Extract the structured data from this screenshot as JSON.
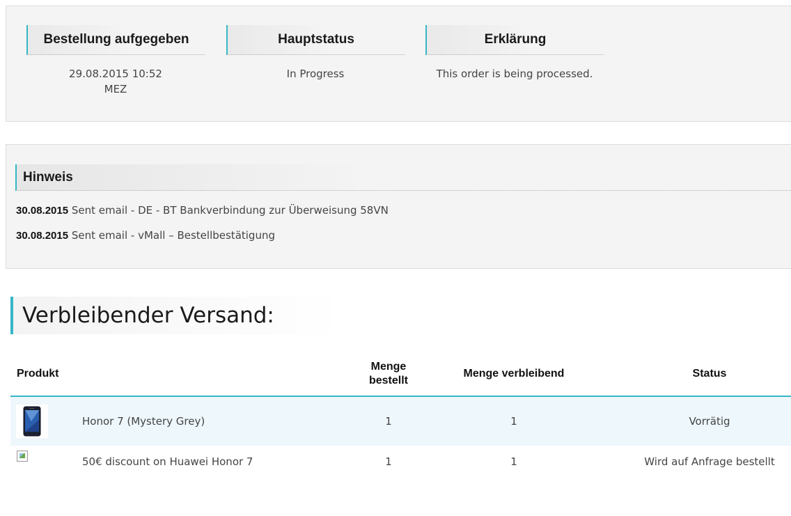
{
  "status_panel": {
    "columns": [
      {
        "header": "Bestellung aufgegeben",
        "value_line1": "29.08.2015 10:52",
        "value_line2": "MEZ"
      },
      {
        "header": "Hauptstatus",
        "value_line1": "In Progress",
        "value_line2": ""
      },
      {
        "header": "Erklärung",
        "value_line1": "This order is being processed.",
        "value_line2": ""
      }
    ]
  },
  "notes": {
    "title": "Hinweis",
    "items": [
      {
        "date": "30.08.2015",
        "text": "Sent email - DE - BT Bankverbindung zur Überweisung 58VN"
      },
      {
        "date": "30.08.2015",
        "text": "Sent email - vMall – Bestellbestätigung"
      }
    ]
  },
  "shipping": {
    "title": "Verbleibender Versand:",
    "headers": {
      "product": "Produkt",
      "qty_ordered_line1": "Menge",
      "qty_ordered_line2": "bestellt",
      "qty_remaining": "Menge verbleibend",
      "status": "Status"
    },
    "rows": [
      {
        "product": "Honor 7 (Mystery Grey)",
        "qty_ordered": "1",
        "qty_remaining": "1",
        "status": "Vorrätig",
        "image": "phone-thumbnail"
      },
      {
        "product": "50€ discount on Huawei Honor 7",
        "qty_ordered": "1",
        "qty_remaining": "1",
        "status": "Wird auf Anfrage bestellt",
        "image": "broken-image-icon"
      }
    ]
  },
  "colors": {
    "accent": "#35b6c6",
    "row_highlight": "#eef7fb",
    "panel_bg": "#f4f4f4"
  }
}
